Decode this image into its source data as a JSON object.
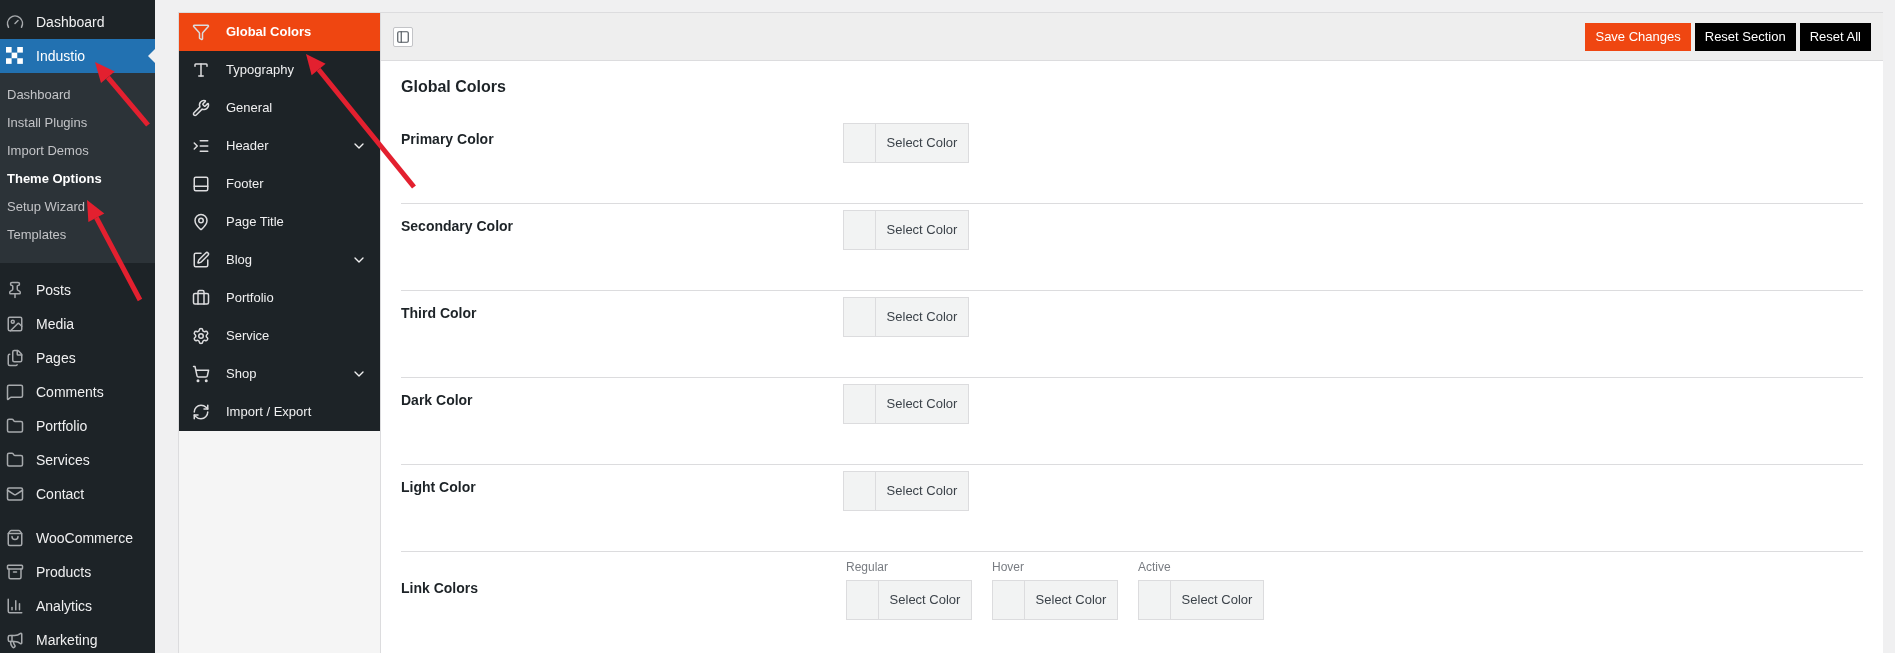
{
  "admin_menu": [
    {
      "label": "Dashboard",
      "selected": false
    },
    {
      "label": "Industio",
      "selected": true,
      "submenu": [
        {
          "label": "Dashboard",
          "selected": false
        },
        {
          "label": "Install Plugins",
          "selected": false
        },
        {
          "label": "Import Demos",
          "selected": false
        },
        {
          "label": "Theme Options",
          "selected": true
        },
        {
          "label": "Setup Wizard",
          "selected": false
        },
        {
          "label": "Templates",
          "selected": false
        }
      ]
    },
    {
      "label": "Posts",
      "selected": false
    },
    {
      "label": "Media",
      "selected": false
    },
    {
      "label": "Pages",
      "selected": false
    },
    {
      "label": "Comments",
      "selected": false
    },
    {
      "label": "Portfolio",
      "selected": false
    },
    {
      "label": "Services",
      "selected": false
    },
    {
      "label": "Contact",
      "selected": false
    },
    {
      "label": "WooCommerce",
      "selected": false
    },
    {
      "label": "Products",
      "selected": false
    },
    {
      "label": "Analytics",
      "selected": false
    },
    {
      "label": "Marketing",
      "selected": false
    }
  ],
  "options_menu": [
    {
      "label": "Global Colors",
      "selected": true,
      "expandable": false
    },
    {
      "label": "Typography",
      "selected": false,
      "expandable": false
    },
    {
      "label": "General",
      "selected": false,
      "expandable": false
    },
    {
      "label": "Header",
      "selected": false,
      "expandable": true
    },
    {
      "label": "Footer",
      "selected": false,
      "expandable": false
    },
    {
      "label": "Page Title",
      "selected": false,
      "expandable": false
    },
    {
      "label": "Blog",
      "selected": false,
      "expandable": true
    },
    {
      "label": "Portfolio",
      "selected": false,
      "expandable": false
    },
    {
      "label": "Service",
      "selected": false,
      "expandable": false
    },
    {
      "label": "Shop",
      "selected": false,
      "expandable": true
    },
    {
      "label": "Import / Export",
      "selected": false,
      "expandable": false
    }
  ],
  "toolbar": {
    "buttons": [
      {
        "label": "Save Changes",
        "kind": "primary"
      },
      {
        "label": "Reset Section",
        "kind": "secondary"
      },
      {
        "label": "Reset All",
        "kind": "secondary"
      }
    ]
  },
  "section": {
    "title": "Global Colors",
    "fields": [
      {
        "label": "Primary Color",
        "kind": "single",
        "button": "Select Color"
      },
      {
        "label": "Secondary Color",
        "kind": "single",
        "button": "Select Color"
      },
      {
        "label": "Third Color",
        "kind": "single",
        "button": "Select Color"
      },
      {
        "label": "Dark Color",
        "kind": "single",
        "button": "Select Color"
      },
      {
        "label": "Light Color",
        "kind": "single",
        "button": "Select Color"
      },
      {
        "label": "Link Colors",
        "kind": "group",
        "pickers": [
          {
            "label": "Regular",
            "button": "Select Color"
          },
          {
            "label": "Hover",
            "button": "Select Color"
          },
          {
            "label": "Active",
            "button": "Select Color"
          }
        ]
      }
    ]
  }
}
